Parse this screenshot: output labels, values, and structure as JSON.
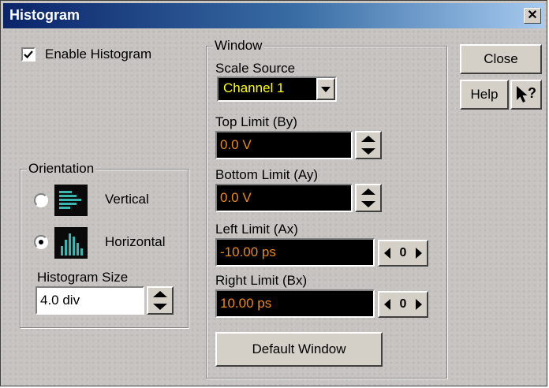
{
  "window": {
    "title": "Histogram",
    "close_symbol": "✕"
  },
  "enable": {
    "label": "Enable Histogram",
    "checked": true
  },
  "orientation": {
    "legend": "Orientation",
    "vertical_label": "Vertical",
    "horizontal_label": "Horizontal",
    "selected": "Horizontal"
  },
  "size": {
    "label": "Histogram Size",
    "value": "4.0 div"
  },
  "window_group": {
    "legend": "Window",
    "scale_source_label": "Scale Source",
    "scale_source_value": "Channel 1",
    "top_label": "Top Limit (By)",
    "top_value": "0.0 V",
    "bottom_label": "Bottom Limit (Ay)",
    "bottom_value": "0.0 V",
    "left_label": "Left Limit (Ax)",
    "left_value": "-10.00 ps",
    "right_label": "Right Limit (Bx)",
    "right_value": "10.00 ps",
    "zero_label": "0",
    "default_button": "Default Window"
  },
  "buttons": {
    "close": "Close",
    "help": "Help",
    "whats_this": "?"
  },
  "colors": {
    "field_bg": "#000000",
    "field_text": "#e88a1a",
    "select_text": "#ffff00",
    "title_start": "#0a246a",
    "title_end": "#a6caf0"
  }
}
